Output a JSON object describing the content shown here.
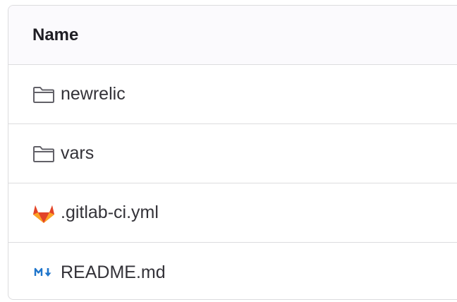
{
  "table": {
    "header": {
      "name_label": "Name"
    },
    "rows": [
      {
        "name": "newrelic",
        "icon": "folder-icon"
      },
      {
        "name": "vars",
        "icon": "folder-icon"
      },
      {
        "name": ".gitlab-ci.yml",
        "icon": "gitlab-logo-icon"
      },
      {
        "name": "README.md",
        "icon": "markdown-icon"
      }
    ]
  },
  "colors": {
    "border": "#dcdcde",
    "header_bg": "#fbfafd",
    "text": "#333238",
    "folder_icon": "#626168",
    "markdown_icon": "#1f75cb",
    "gitlab_orange": "#e24329",
    "gitlab_light": "#fca326"
  }
}
